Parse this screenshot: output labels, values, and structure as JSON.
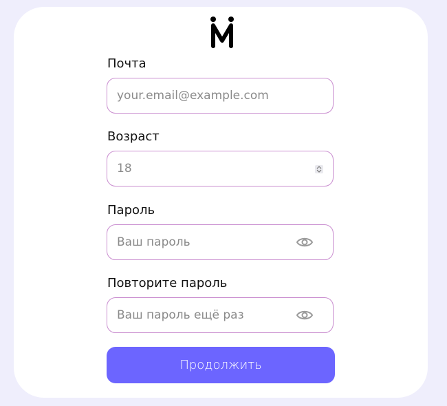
{
  "form": {
    "email": {
      "label": "Почта",
      "placeholder": "your.email@example.com"
    },
    "age": {
      "label": "Возраст",
      "value": "18"
    },
    "password": {
      "label": "Пароль",
      "placeholder": "Ваш пароль",
      "icon": "eye-icon"
    },
    "password_repeat": {
      "label": "Повторите пароль",
      "placeholder": "Ваш пароль ещё раз",
      "icon": "eye-icon"
    },
    "submit_label": "Продолжить"
  },
  "colors": {
    "background": "#efeefc",
    "card": "#ffffff",
    "input_border": "#c98ccf",
    "button": "#6c65ff"
  }
}
